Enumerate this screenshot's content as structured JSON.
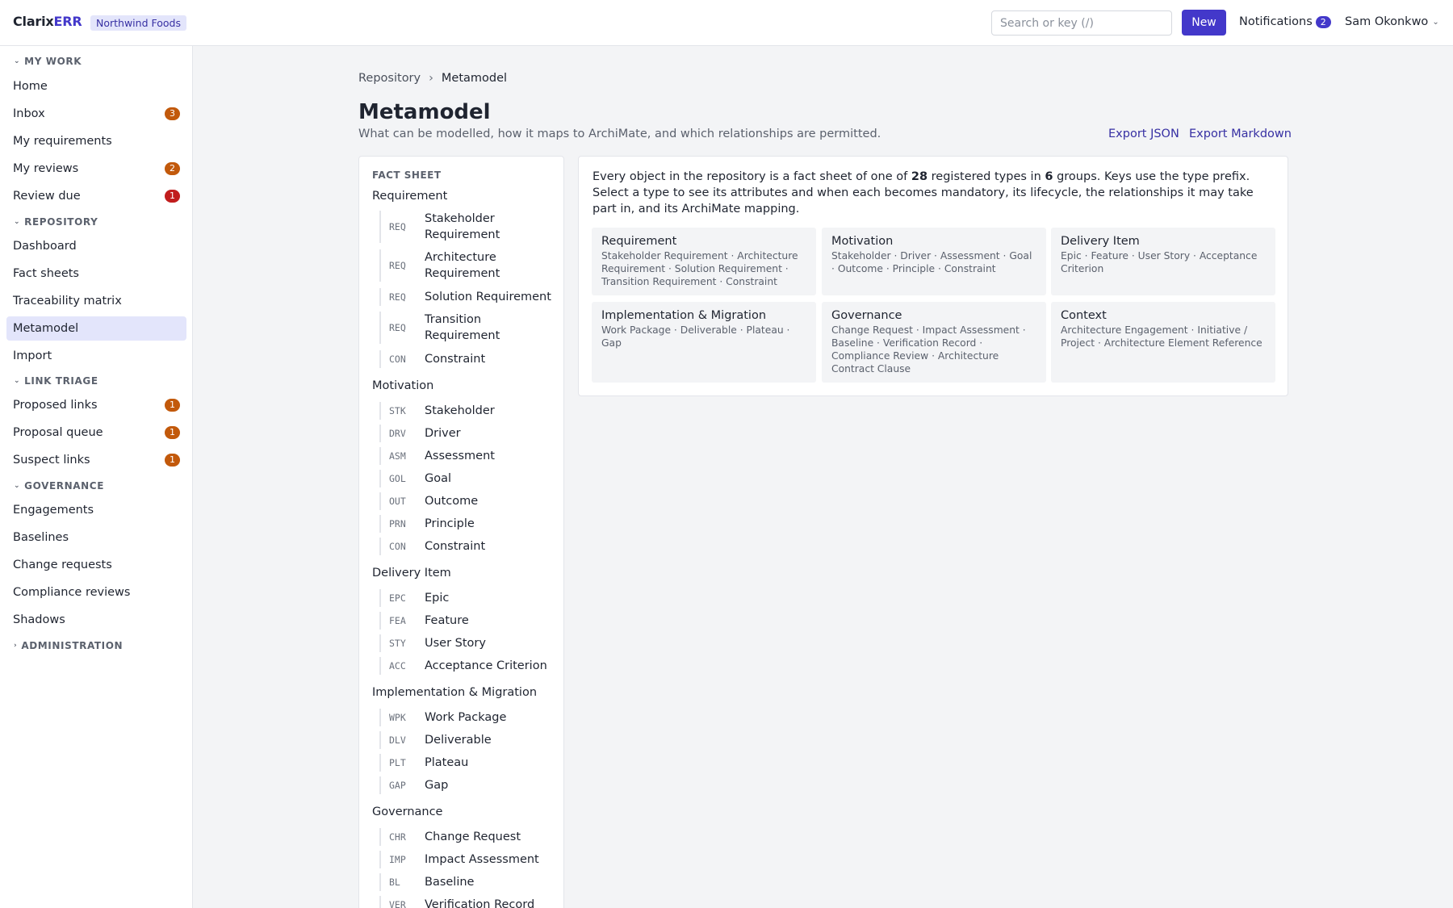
{
  "topbar": {
    "brand_a": "Clarix",
    "brand_b": "ERR",
    "tenant": "Northwind Foods",
    "search_placeholder": "Search or key (/)",
    "new_label": "New",
    "notifications_label": "Notifications",
    "notifications_count": "2",
    "user_name": "Sam Okonkwo"
  },
  "sidebar": {
    "sections": [
      {
        "label": "MY WORK",
        "expanded": true
      },
      {
        "label": "REPOSITORY",
        "expanded": true
      },
      {
        "label": "LINK TRIAGE",
        "expanded": true
      },
      {
        "label": "GOVERNANCE",
        "expanded": true
      },
      {
        "label": "ADMINISTRATION",
        "expanded": false
      }
    ],
    "items": [
      {
        "label": "Home"
      },
      {
        "label": "Inbox",
        "count": "3"
      },
      {
        "label": "My requirements"
      },
      {
        "label": "My reviews",
        "count": "2"
      },
      {
        "label": "Review due",
        "count": "1"
      },
      {
        "label": "Dashboard"
      },
      {
        "label": "Fact sheets"
      },
      {
        "label": "Traceability matrix"
      },
      {
        "label": "Metamodel",
        "active": true
      },
      {
        "label": "Import"
      },
      {
        "label": "Proposed links",
        "count": "1"
      },
      {
        "label": "Proposal queue",
        "count": "1"
      },
      {
        "label": "Suspect links",
        "count": "1"
      },
      {
        "label": "Engagements"
      },
      {
        "label": "Baselines"
      },
      {
        "label": "Change requests"
      },
      {
        "label": "Compliance reviews"
      },
      {
        "label": "Shadows"
      }
    ]
  },
  "breadcrumb": {
    "root": "Repository",
    "sep": "›",
    "current": "Metamodel"
  },
  "page": {
    "title": "Metamodel",
    "subtitle": "What can be modelled, how it maps to ArchiMate, and which relationships are permitted.",
    "export_json": "Export JSON",
    "export_markdown": "Export Markdown"
  },
  "factsheet": {
    "heading": "FACT SHEET",
    "groups": [
      {
        "name": "Requirement",
        "types": [
          {
            "code": "REQ",
            "name": "Stakeholder Requirement"
          },
          {
            "code": "REQ",
            "name": "Architecture Requirement"
          },
          {
            "code": "REQ",
            "name": "Solution Requirement"
          },
          {
            "code": "REQ",
            "name": "Transition Requirement"
          },
          {
            "code": "CON",
            "name": "Constraint"
          }
        ]
      },
      {
        "name": "Motivation",
        "types": [
          {
            "code": "STK",
            "name": "Stakeholder"
          },
          {
            "code": "DRV",
            "name": "Driver"
          },
          {
            "code": "ASM",
            "name": "Assessment"
          },
          {
            "code": "GOL",
            "name": "Goal"
          },
          {
            "code": "OUT",
            "name": "Outcome"
          },
          {
            "code": "PRN",
            "name": "Principle"
          },
          {
            "code": "CON",
            "name": "Constraint"
          }
        ]
      },
      {
        "name": "Delivery Item",
        "types": [
          {
            "code": "EPC",
            "name": "Epic"
          },
          {
            "code": "FEA",
            "name": "Feature"
          },
          {
            "code": "STY",
            "name": "User Story"
          },
          {
            "code": "ACC",
            "name": "Acceptance Criterion"
          }
        ]
      },
      {
        "name": "Implementation & Migration",
        "types": [
          {
            "code": "WPK",
            "name": "Work Package"
          },
          {
            "code": "DLV",
            "name": "Deliverable"
          },
          {
            "code": "PLT",
            "name": "Plateau"
          },
          {
            "code": "GAP",
            "name": "Gap"
          }
        ]
      },
      {
        "name": "Governance",
        "types": [
          {
            "code": "CHR",
            "name": "Change Request"
          },
          {
            "code": "IMP",
            "name": "Impact Assessment"
          },
          {
            "code": "BL",
            "name": "Baseline"
          },
          {
            "code": "VER",
            "name": "Verification Record"
          }
        ]
      }
    ]
  },
  "overview": {
    "intro_a": "Every object in the repository is a fact sheet of one of ",
    "type_count": "28",
    "intro_b": " registered types in ",
    "group_count": "6",
    "intro_c": " groups. Keys use the type prefix. Select a type to see its attributes and when each becomes mandatory, its lifecycle, the relationships it may take part in, and its ArchiMate mapping.",
    "cards": [
      {
        "title": "Requirement",
        "desc": "Stakeholder Requirement · Architecture Requirement · Solution Requirement · Transition Requirement · Constraint"
      },
      {
        "title": "Motivation",
        "desc": "Stakeholder · Driver · Assessment · Goal · Outcome · Principle · Constraint"
      },
      {
        "title": "Delivery Item",
        "desc": "Epic · Feature · User Story · Acceptance Criterion"
      },
      {
        "title": "Implementation & Migration",
        "desc": "Work Package · Deliverable · Plateau · Gap"
      },
      {
        "title": "Governance",
        "desc": "Change Request · Impact Assessment · Baseline · Verification Record · Compliance Review · Architecture Contract Clause"
      },
      {
        "title": "Context",
        "desc": "Architecture Engagement · Initiative / Project · Architecture Element Reference"
      }
    ]
  },
  "colors": {
    "accent": "#4338ca",
    "badge_orange": "#c2590b",
    "badge_red": "#c11d1d",
    "active_bg": "#e3e5fb"
  }
}
